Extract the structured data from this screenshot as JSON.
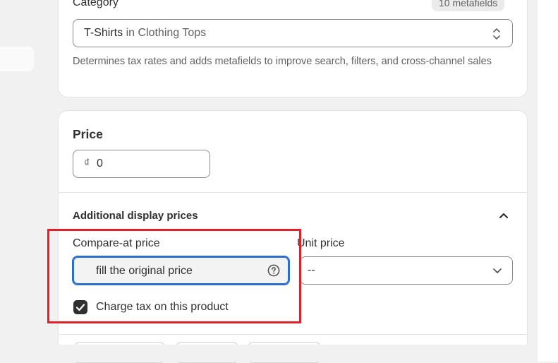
{
  "category": {
    "label": "Category",
    "badge": "10 metafields",
    "selected_main": "T-Shirts",
    "selected_sub": " in Clothing Tops",
    "help": "Determines tax rates and adds metafields to improve search, filters, and cross-channel sales"
  },
  "price": {
    "title": "Price",
    "currency_symbol": "₫",
    "value": "0"
  },
  "additional": {
    "title": "Additional display prices",
    "compare_label": "Compare-at price",
    "compare_value": "fill the original price",
    "unit_label": "Unit price",
    "unit_value": "--",
    "charge_tax_label": "Charge tax on this product",
    "charge_tax_checked": true
  },
  "colors": {
    "focus": "#2c6ecb",
    "highlight": "#e0202a",
    "text": "#303030"
  }
}
